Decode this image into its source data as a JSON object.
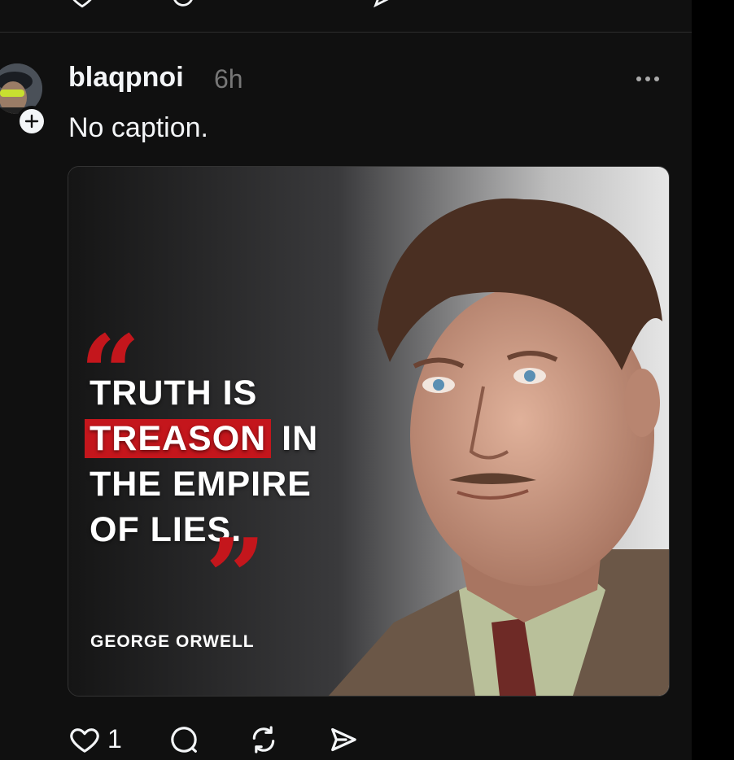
{
  "post": {
    "username": "blaqpnoi",
    "timestamp": "6h",
    "caption": "No caption.",
    "avatar_icon": "avatar-icon",
    "follow_icon": "plus-icon",
    "more_icon": "more-icon"
  },
  "media": {
    "quote_line_1": "TRUTH IS",
    "quote_highlight": "TREASON",
    "quote_line_2_rest": " IN",
    "quote_line_3": "THE EMPIRE",
    "quote_line_4": "OF LIES.",
    "open_quote": "“",
    "close_quote": "”",
    "author": "GEORGE ORWELL",
    "accent_color": "#c4161c"
  },
  "actions": {
    "like_count": "1",
    "like_icon": "heart-icon",
    "comment_icon": "comment-icon",
    "repost_icon": "repost-icon",
    "share_icon": "send-icon"
  }
}
